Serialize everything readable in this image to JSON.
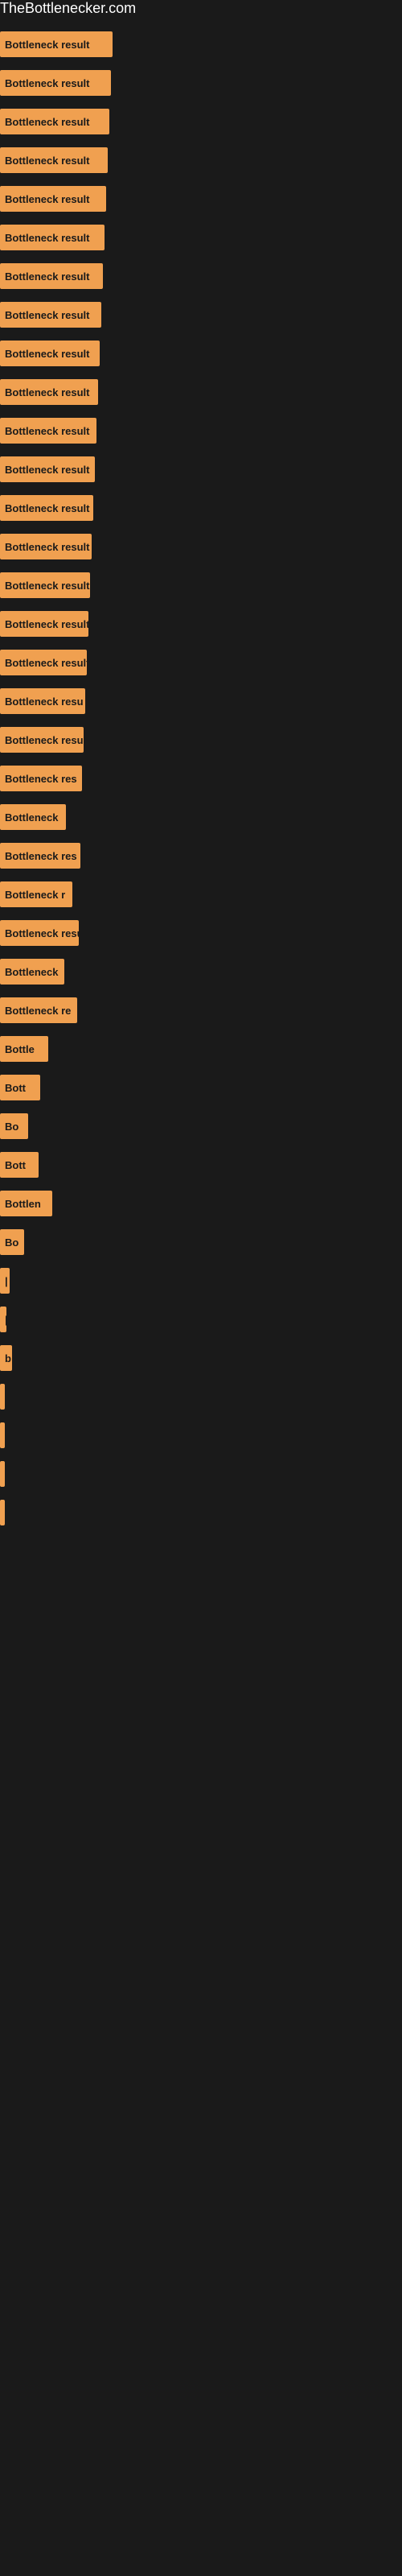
{
  "site": {
    "title": "TheBottlenecker.com"
  },
  "bars": [
    {
      "label": "Bottleneck result",
      "width": 140
    },
    {
      "label": "Bottleneck result",
      "width": 138
    },
    {
      "label": "Bottleneck result",
      "width": 136
    },
    {
      "label": "Bottleneck result",
      "width": 134
    },
    {
      "label": "Bottleneck result",
      "width": 132
    },
    {
      "label": "Bottleneck result",
      "width": 130
    },
    {
      "label": "Bottleneck result",
      "width": 128
    },
    {
      "label": "Bottleneck result",
      "width": 126
    },
    {
      "label": "Bottleneck result",
      "width": 124
    },
    {
      "label": "Bottleneck result",
      "width": 122
    },
    {
      "label": "Bottleneck result",
      "width": 120
    },
    {
      "label": "Bottleneck result",
      "width": 118
    },
    {
      "label": "Bottleneck result",
      "width": 116
    },
    {
      "label": "Bottleneck result",
      "width": 114
    },
    {
      "label": "Bottleneck result",
      "width": 112
    },
    {
      "label": "Bottleneck result",
      "width": 110
    },
    {
      "label": "Bottleneck result",
      "width": 108
    },
    {
      "label": "Bottleneck resu",
      "width": 106
    },
    {
      "label": "Bottleneck result",
      "width": 104
    },
    {
      "label": "Bottleneck res",
      "width": 102
    },
    {
      "label": "Bottleneck",
      "width": 82
    },
    {
      "label": "Bottleneck res",
      "width": 100
    },
    {
      "label": "Bottleneck r",
      "width": 90
    },
    {
      "label": "Bottleneck resu",
      "width": 98
    },
    {
      "label": "Bottleneck",
      "width": 80
    },
    {
      "label": "Bottleneck re",
      "width": 96
    },
    {
      "label": "Bottle",
      "width": 60
    },
    {
      "label": "Bott",
      "width": 50
    },
    {
      "label": "Bo",
      "width": 35
    },
    {
      "label": "Bott",
      "width": 48
    },
    {
      "label": "Bottlen",
      "width": 65
    },
    {
      "label": "Bo",
      "width": 30
    },
    {
      "label": "|",
      "width": 12
    },
    {
      "label": "|",
      "width": 8
    },
    {
      "label": "b",
      "width": 15
    },
    {
      "label": "",
      "width": 5
    },
    {
      "label": "",
      "width": 5
    },
    {
      "label": "",
      "width": 5
    },
    {
      "label": "",
      "width": 5
    }
  ]
}
